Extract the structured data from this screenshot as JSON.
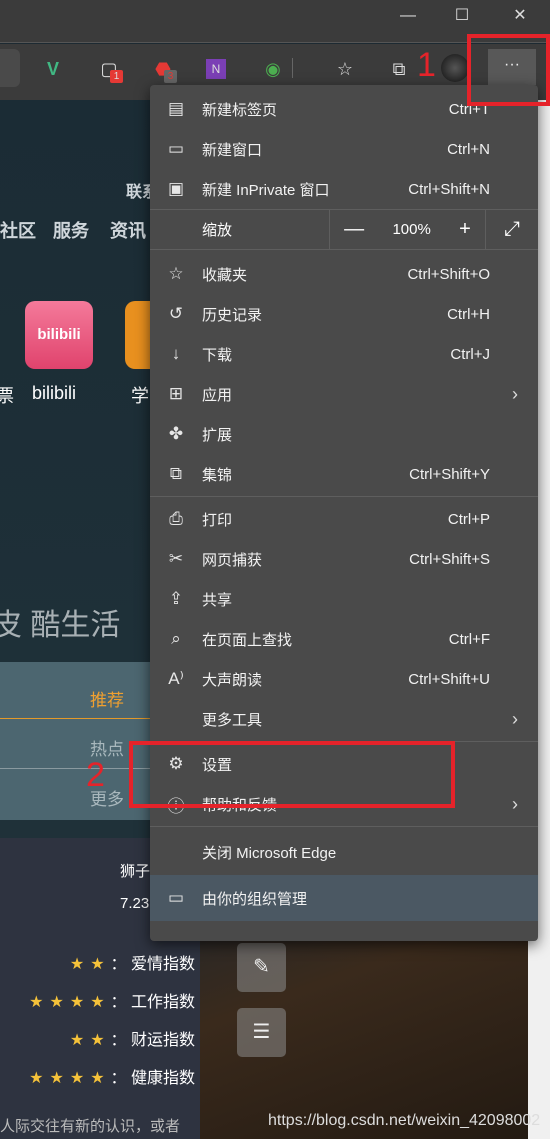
{
  "window": {
    "minimize": "—",
    "maximize": "☐",
    "close": "✕"
  },
  "toolbar": {
    "badges": {
      "ext1": "1",
      "abp": "3"
    },
    "more": "···"
  },
  "page": {
    "nav_top": "联系",
    "nav": [
      "社区",
      "服务",
      "资讯"
    ],
    "app_partial_left": "票",
    "app": "bilibili",
    "app_logo_text": "bilibili",
    "app_partial_right": "学",
    "slogan": "皮 酷生活",
    "tabs": [
      "推荐",
      "热点",
      "更多"
    ],
    "horoscope": {
      "sign": "狮子",
      "date": "7.23",
      "rows": [
        {
          "stars": 2,
          "label": "： 爱情指数"
        },
        {
          "stars": 4,
          "label": "： 工作指数"
        },
        {
          "stars": 2,
          "label": "： 财运指数"
        },
        {
          "stars": 4,
          "label": "： 健康指数"
        }
      ]
    },
    "bottom_text": "人际交往有新的认识，或者",
    "watermark": "https://blog.csdn.net/weixin_42098002"
  },
  "menu": {
    "items": [
      {
        "label": "新建标签页",
        "shortcut": "Ctrl+T",
        "icon": "new-tab-icon"
      },
      {
        "label": "新建窗口",
        "shortcut": "Ctrl+N",
        "icon": "new-window-icon"
      },
      {
        "label": "新建 InPrivate 窗口",
        "shortcut": "Ctrl+Shift+N",
        "icon": "inprivate-icon"
      }
    ],
    "zoom": {
      "label": "缩放",
      "minus": "—",
      "value": "100%",
      "plus": "+",
      "fullscreen": "⤢"
    },
    "items2": [
      {
        "label": "收藏夹",
        "shortcut": "Ctrl+Shift+O",
        "icon": "favorites-icon"
      },
      {
        "label": "历史记录",
        "shortcut": "Ctrl+H",
        "icon": "history-icon"
      },
      {
        "label": "下载",
        "shortcut": "Ctrl+J",
        "icon": "download-icon"
      },
      {
        "label": "应用",
        "shortcut": "",
        "icon": "apps-icon"
      },
      {
        "label": "扩展",
        "shortcut": "",
        "icon": "extensions-icon"
      },
      {
        "label": "集锦",
        "shortcut": "Ctrl+Shift+Y",
        "icon": "collections-icon"
      }
    ],
    "items3": [
      {
        "label": "打印",
        "shortcut": "Ctrl+P",
        "icon": "print-icon"
      },
      {
        "label": "网页捕获",
        "shortcut": "Ctrl+Shift+S",
        "icon": "web-capture-icon"
      },
      {
        "label": "共享",
        "shortcut": "",
        "icon": "share-icon"
      },
      {
        "label": "在页面上查找",
        "shortcut": "Ctrl+F",
        "icon": "find-icon"
      },
      {
        "label": "大声朗读",
        "shortcut": "Ctrl+Shift+U",
        "icon": "read-aloud-icon"
      },
      {
        "label": "更多工具",
        "shortcut": "",
        "icon": ""
      }
    ],
    "settings": "设置",
    "help": "帮助和反馈",
    "close_edge": "关闭 Microsoft Edge",
    "managed": "由你的组织管理"
  },
  "annotations": {
    "step1": "1",
    "step2": "2",
    "color": "#e5232a"
  }
}
